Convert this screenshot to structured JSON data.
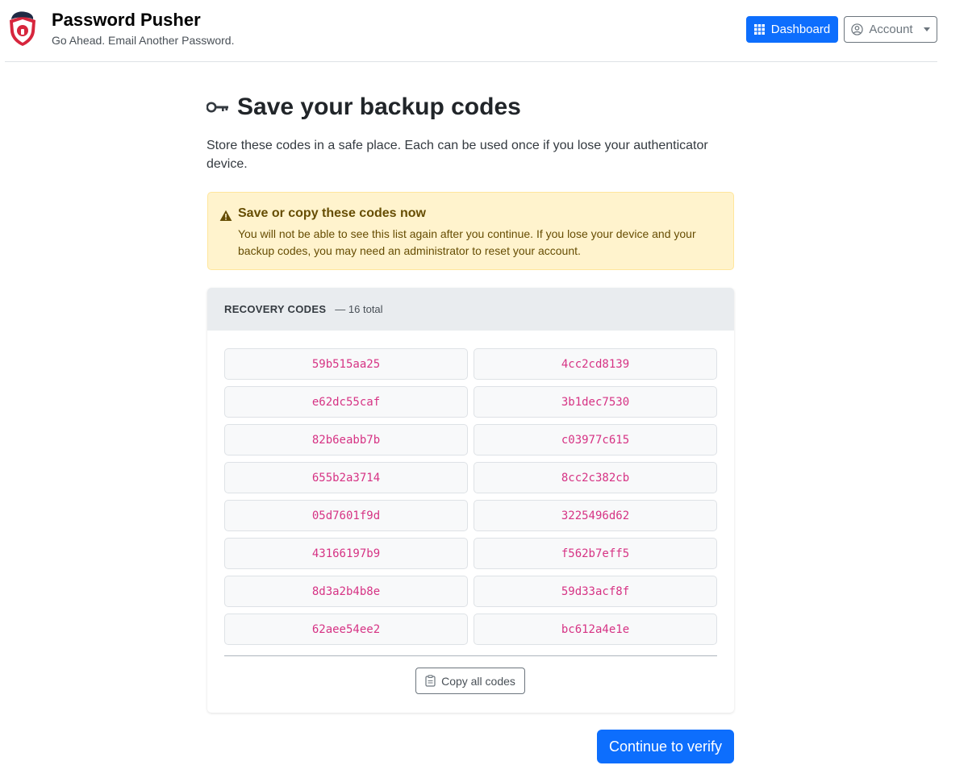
{
  "brand": {
    "name": "Password Pusher",
    "tagline": "Go Ahead. Email Another Password.",
    "logo_icon": "shield-lock-logo"
  },
  "nav": {
    "dashboard_label": "Dashboard",
    "dashboard_icon": "grid-icon",
    "account_label": "Account",
    "account_icon": "person-circle-icon"
  },
  "page": {
    "title": "Save your backup codes",
    "title_icon": "key-icon",
    "intro": "Store these codes in a safe place. Each can be used once if you lose your authenticator device."
  },
  "alert": {
    "title": "Save or copy these codes now",
    "body": "You will not be able to see this list again after you continue. If you lose your device and your backup codes, you may need an administrator to reset your account.",
    "icon": "warning-triangle-icon"
  },
  "codes_card": {
    "header_label": "RECOVERY CODES",
    "header_count": "— 16 total",
    "codes": [
      "59b515aa25",
      "4cc2cd8139",
      "e62dc55caf",
      "3b1dec7530",
      "82b6eabb7b",
      "c03977c615",
      "655b2a3714",
      "8cc2c382cb",
      "05d7601f9d",
      "3225496d62",
      "43166197b9",
      "f562b7eff5",
      "8d3a2b4b8e",
      "59d33acf8f",
      "62aee54ee2",
      "bc612a4e1e"
    ],
    "copy_label": "Copy all codes",
    "copy_icon": "clipboard-icon"
  },
  "actions": {
    "continue_label": "Continue to verify"
  },
  "colors": {
    "primary": "#0d6efd",
    "code_text": "#d63384",
    "alert_bg": "#fff3cd",
    "alert_text": "#664d03"
  }
}
